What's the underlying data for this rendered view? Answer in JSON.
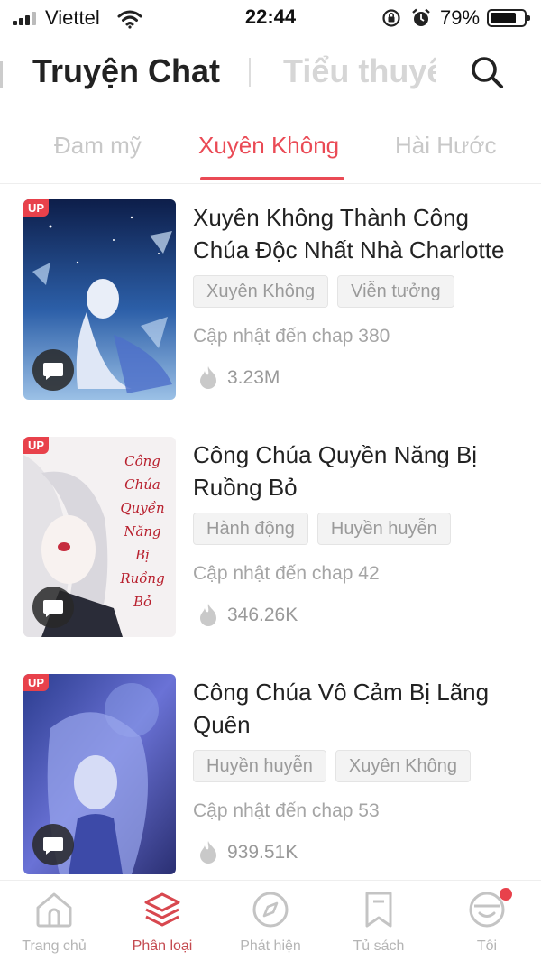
{
  "status_bar": {
    "carrier": "Viettel",
    "time": "22:44",
    "battery_percent": "79%",
    "battery_level": 0.79
  },
  "header": {
    "title": "Truyện Chat",
    "alt_tab": "Tiểu thuyết"
  },
  "category_tabs": [
    {
      "label": "Đam mỹ",
      "active": false
    },
    {
      "label": "Xuyên Không",
      "active": true
    },
    {
      "label": "Hài Hước",
      "active": false
    }
  ],
  "stories": [
    {
      "badge": "UP",
      "title": "Xuyên Không Thành Công Chúa Độc Nhất Nhà Charlotte",
      "tags": [
        "Xuyên Không",
        "Viễn tưởng"
      ],
      "chapter": "Cập nhật đến chap 380",
      "views": "3.23M"
    },
    {
      "badge": "UP",
      "title": "Công Chúa Quyền Năng Bị Ruồng Bỏ",
      "tags": [
        "Hành động",
        "Huyền huyễn"
      ],
      "chapter": "Cập nhật đến chap 42",
      "views": "346.26K",
      "cover_text": [
        "Công",
        "Chúa",
        "Quyền",
        "Năng",
        "Bị",
        "Ruồng",
        "Bỏ"
      ]
    },
    {
      "badge": "UP",
      "title": "Công Chúa Vô Cảm Bị Lãng Quên",
      "tags": [
        "Huyền huyễn",
        "Xuyên Không"
      ],
      "chapter": "Cập nhật đến chap 53",
      "views": "939.51K"
    }
  ],
  "bottom_nav": [
    {
      "label": "Trang chủ",
      "icon": "home-icon",
      "active": false
    },
    {
      "label": "Phân loại",
      "icon": "layers-icon",
      "active": true
    },
    {
      "label": "Phát hiện",
      "icon": "compass-icon",
      "active": false
    },
    {
      "label": "Tủ sách",
      "icon": "bookmark-icon",
      "active": false
    },
    {
      "label": "Tôi",
      "icon": "profile-icon",
      "active": false,
      "notification": true
    }
  ],
  "colors": {
    "accent": "#ea4a55",
    "badge": "#e8414b",
    "muted_text": "#a5a5a5"
  }
}
